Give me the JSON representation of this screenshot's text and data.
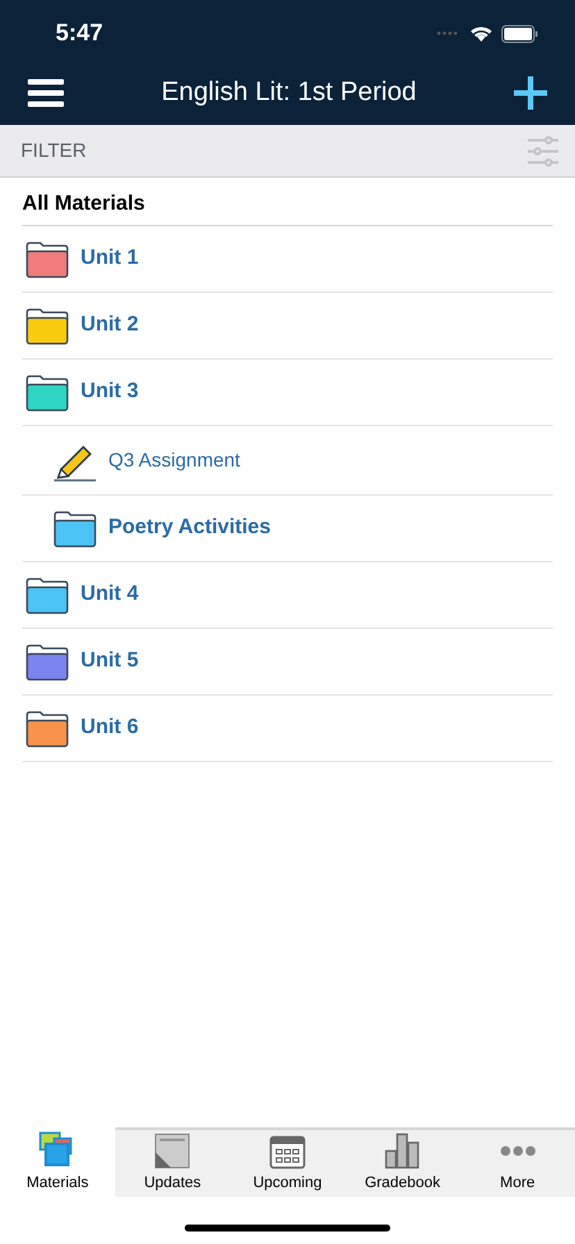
{
  "status_bar": {
    "time": "5:47"
  },
  "nav_bar": {
    "title": "English Lit: 1st Period"
  },
  "filter": {
    "label": "FILTER"
  },
  "section": {
    "title": "All Materials"
  },
  "items": [
    {
      "kind": "folder",
      "label": "Unit 1",
      "color": "#f07c7c"
    },
    {
      "kind": "folder",
      "label": "Unit 2",
      "color": "#f9cc0f"
    },
    {
      "kind": "folder",
      "label": "Unit 3",
      "color": "#2fd6c3",
      "children": [
        {
          "kind": "assignment",
          "label": "Q3 Assignment"
        },
        {
          "kind": "folder",
          "label": "Poetry Activities",
          "color": "#4cc3f5"
        }
      ]
    },
    {
      "kind": "folder",
      "label": "Unit 4",
      "color": "#4cc3f5"
    },
    {
      "kind": "folder",
      "label": "Unit 5",
      "color": "#7b83ee"
    },
    {
      "kind": "folder",
      "label": "Unit 6",
      "color": "#f7934a"
    }
  ],
  "tabs": [
    {
      "kind": "materials",
      "label": "Materials",
      "selected": true
    },
    {
      "kind": "updates",
      "label": "Updates",
      "selected": false
    },
    {
      "kind": "upcoming",
      "label": "Upcoming",
      "selected": false
    },
    {
      "kind": "gradebook",
      "label": "Gradebook",
      "selected": false
    },
    {
      "kind": "more",
      "label": "More",
      "selected": false
    }
  ]
}
